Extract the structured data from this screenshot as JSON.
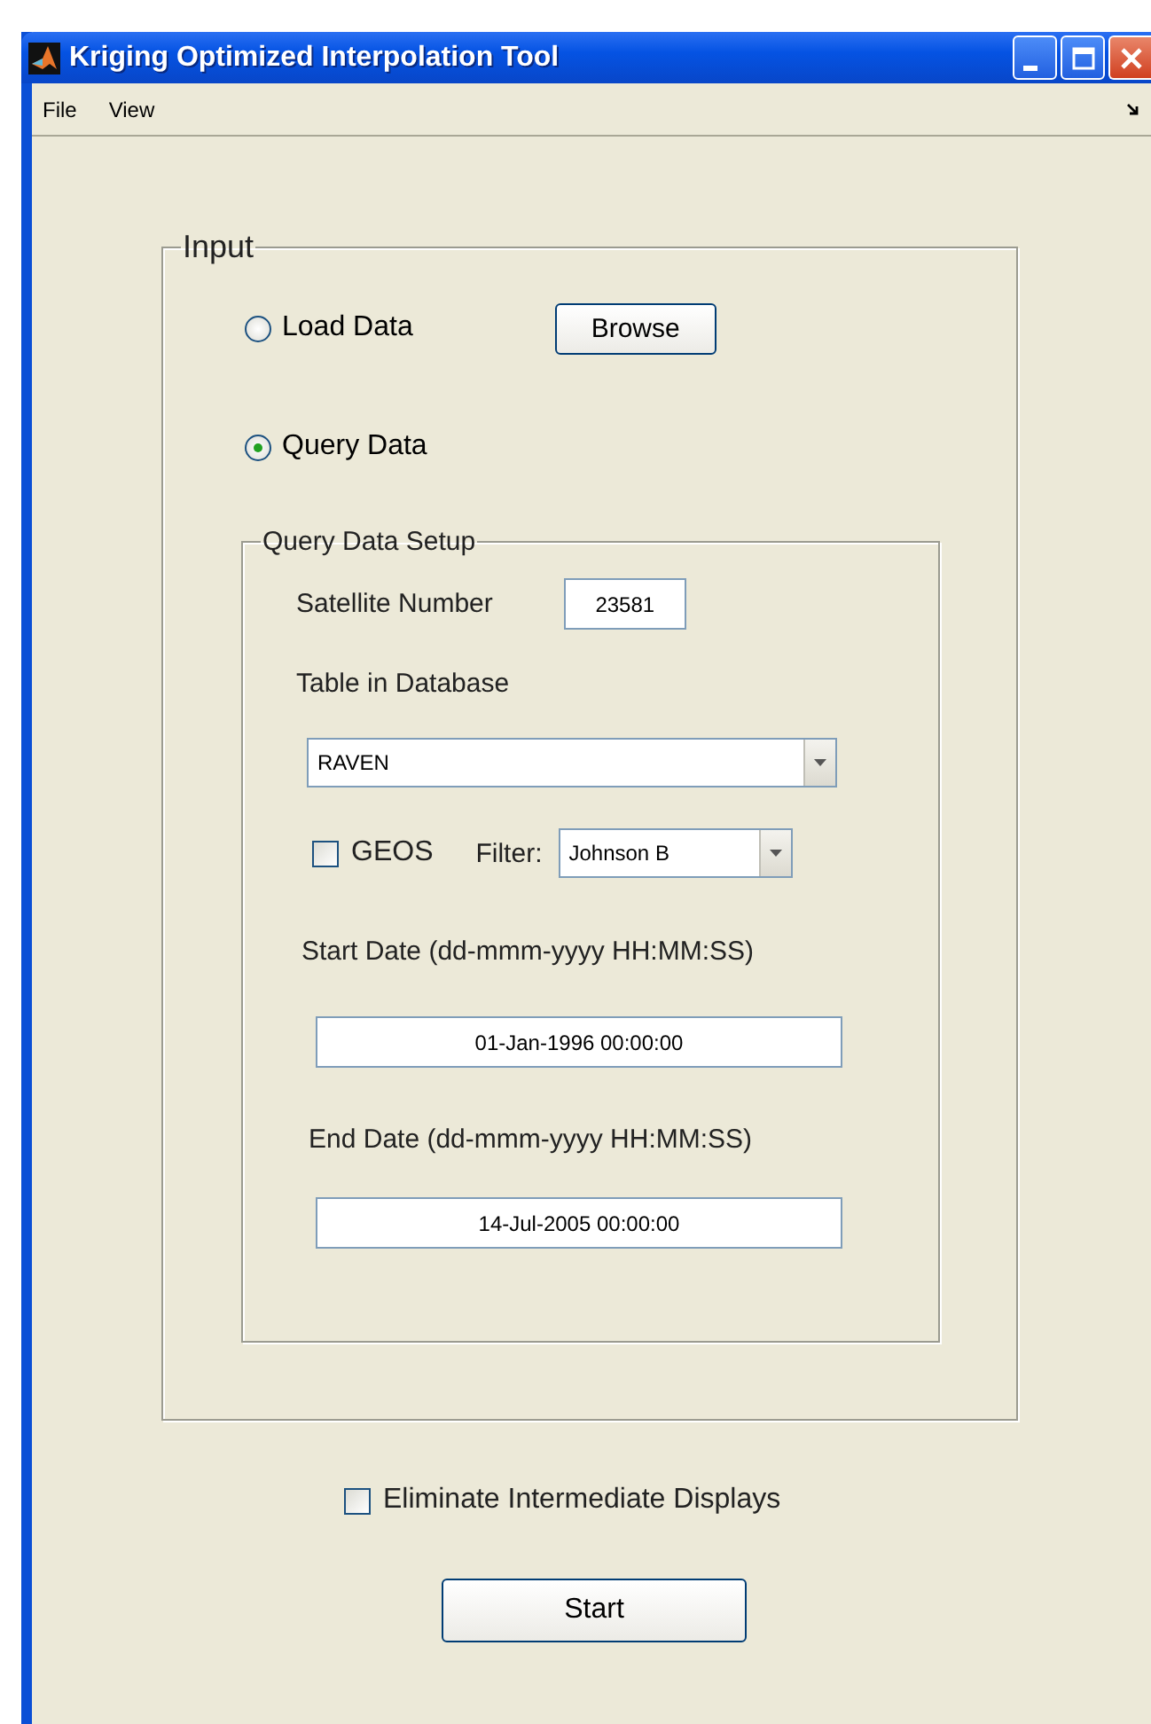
{
  "window": {
    "title": "Kriging Optimized Interpolation Tool"
  },
  "menu": [
    "File",
    "View"
  ],
  "input_panel": {
    "title": "Input",
    "source_options": [
      {
        "label": "Load Data",
        "selected": false
      },
      {
        "label": "Query Data",
        "selected": true
      }
    ],
    "browse_button": "Browse",
    "query_setup": {
      "title": "Query Data Setup",
      "satellite_number": {
        "label": "Satellite Number",
        "value": "23581"
      },
      "table": {
        "label": "Table in Database",
        "value": "RAVEN"
      },
      "geos": {
        "label": "GEOS",
        "checked": false
      },
      "filter": {
        "label": "Filter:",
        "value": "Johnson B"
      },
      "start_date": {
        "label": "Start Date (dd-mmm-yyyy HH:MM:SS)",
        "value": "01-Jan-1996 00:00:00"
      },
      "end_date": {
        "label": "End Date (dd-mmm-yyyy HH:MM:SS)",
        "value": "14-Jul-2005 00:00:00"
      }
    }
  },
  "eliminate_displays": {
    "label": "Eliminate Intermediate Displays",
    "checked": false
  },
  "start_button": "Start"
}
